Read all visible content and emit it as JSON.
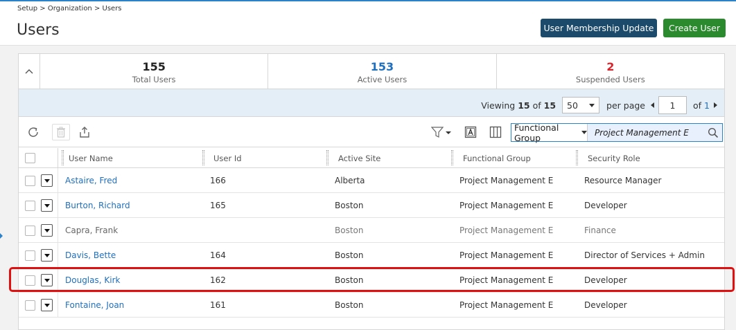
{
  "breadcrumb": "Setup > Organization > Users",
  "page_title": "Users",
  "buttons": {
    "membership": "User Membership Update",
    "create": "Create User"
  },
  "stats": [
    {
      "value": "155",
      "label": "Total Users",
      "color": "#222222"
    },
    {
      "value": "153",
      "label": "Active Users",
      "color": "#1f6fbf"
    },
    {
      "value": "2",
      "label": "Suspended Users",
      "color": "#d9232a"
    }
  ],
  "pager": {
    "viewing_label": "Viewing",
    "viewing_count": "15",
    "of_label": "of",
    "total": "15",
    "per_page_value": "50",
    "per_page_label": "per page",
    "page_value": "1",
    "of_pages_label": "of",
    "pages_total": "1"
  },
  "toolbar": {
    "search_field": "Functional Group",
    "search_value": "Project Management E",
    "icons": [
      "refresh-icon",
      "delete-icon",
      "export-icon",
      "filter-icon",
      "font-icon",
      "columns-icon",
      "search-icon"
    ]
  },
  "columns": [
    "User Name",
    "User Id",
    "Active Site",
    "Functional Group",
    "Security Role"
  ],
  "rows": [
    {
      "name": "Astaire, Fred",
      "id": "166",
      "site": "Alberta",
      "group": "Project Management E",
      "role": "Resource Manager"
    },
    {
      "name": "Burton, Richard",
      "id": "165",
      "site": "Boston",
      "group": "Project Management E",
      "role": "Developer"
    },
    {
      "name": "Capra, Frank",
      "id": "",
      "site": "Boston",
      "group": "Project Management E",
      "role": "Finance"
    },
    {
      "name": "Davis, Bette",
      "id": "164",
      "site": "Boston",
      "group": "Project Management E",
      "role": "Director of Services + Admin"
    },
    {
      "name": "Douglas, Kirk",
      "id": "162",
      "site": "Boston",
      "group": "Project Management E",
      "role": "Developer"
    },
    {
      "name": "Fontaine, Joan",
      "id": "161",
      "site": "Boston",
      "group": "Project Management E",
      "role": "Developer"
    }
  ],
  "colors": {
    "primary_button": "#1c4a6b",
    "create_button": "#2b8a2e",
    "link": "#1f6fbf",
    "highlight": "#e01010"
  }
}
